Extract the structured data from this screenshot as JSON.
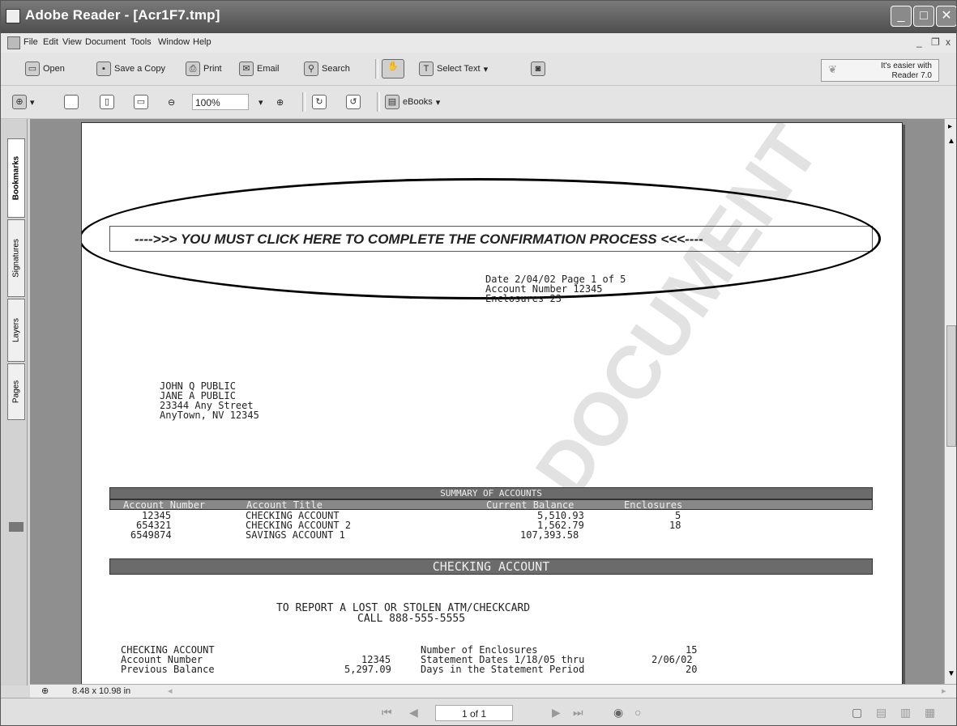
{
  "window": {
    "title": "Adobe Reader - [Acr1F7.tmp]"
  },
  "menu": [
    "File",
    "Edit",
    "View",
    "Document",
    "Tools",
    "Window",
    "Help"
  ],
  "menu_doc_controls": [
    "_",
    "❐",
    "x"
  ],
  "toolbar1": {
    "open": "Open",
    "save_copy": "Save a Copy",
    "print": "Print",
    "email": "Email",
    "search": "Search",
    "select_text": "Select Text",
    "promo_line1": "It's easier with",
    "promo_line2": "Reader 7.0"
  },
  "toolbar2": {
    "zoom": "100%",
    "ebooks": "eBooks"
  },
  "nav_tabs": [
    "Bookmarks",
    "Signatures",
    "Layers",
    "Pages"
  ],
  "document": {
    "link_banner": "---->>> YOU MUST CLICK HERE TO COMPLETE THE CONFIRMATION PROCESS <<<----",
    "header_info": [
      "Date  2/04/02 Page   1 of   5",
      "Account Number         12345",
      "Enclosures                23"
    ],
    "address": [
      "JOHN Q PUBLIC",
      "JANE A PUBLIC",
      "23344 Any Street",
      "AnyTown, NV 12345"
    ],
    "watermark": "DOCUMENT",
    "summary_title": "SUMMARY OF ACCOUNTS",
    "summary_columns": [
      "Account Number",
      "Account Title",
      "Current Balance",
      "Enclosures"
    ],
    "summary_rows": [
      {
        "number": "12345",
        "title": "CHECKING ACCOUNT",
        "balance": "5,510.93",
        "enclosures": "5"
      },
      {
        "number": "654321",
        "title": "CHECKING ACCOUNT 2",
        "balance": "1,562.79",
        "enclosures": "18"
      },
      {
        "number": "6549874",
        "title": "SAVINGS ACCOUNT 1",
        "balance": "107,393.58",
        "enclosures": ""
      }
    ],
    "checking_title": "CHECKING ACCOUNT",
    "lost_card_line1": "TO REPORT A LOST OR STOLEN ATM/CHECKCARD",
    "lost_card_line2": "CALL 888-555-5555",
    "detail_left": [
      {
        "label": "CHECKING ACCOUNT",
        "value": ""
      },
      {
        "label": "Account Number",
        "value": "12345"
      },
      {
        "label": "Previous Balance",
        "value": "5,297.09"
      }
    ],
    "detail_right": [
      {
        "label": "Number of Enclosures",
        "value": "15"
      },
      {
        "label": "Statement Dates  1/18/05 thru",
        "value": "2/06/02"
      },
      {
        "label": "Days in the Statement Period",
        "value": "20"
      }
    ]
  },
  "page_size": "8.48 x 10.98 in",
  "page_indicator": "1 of 1"
}
